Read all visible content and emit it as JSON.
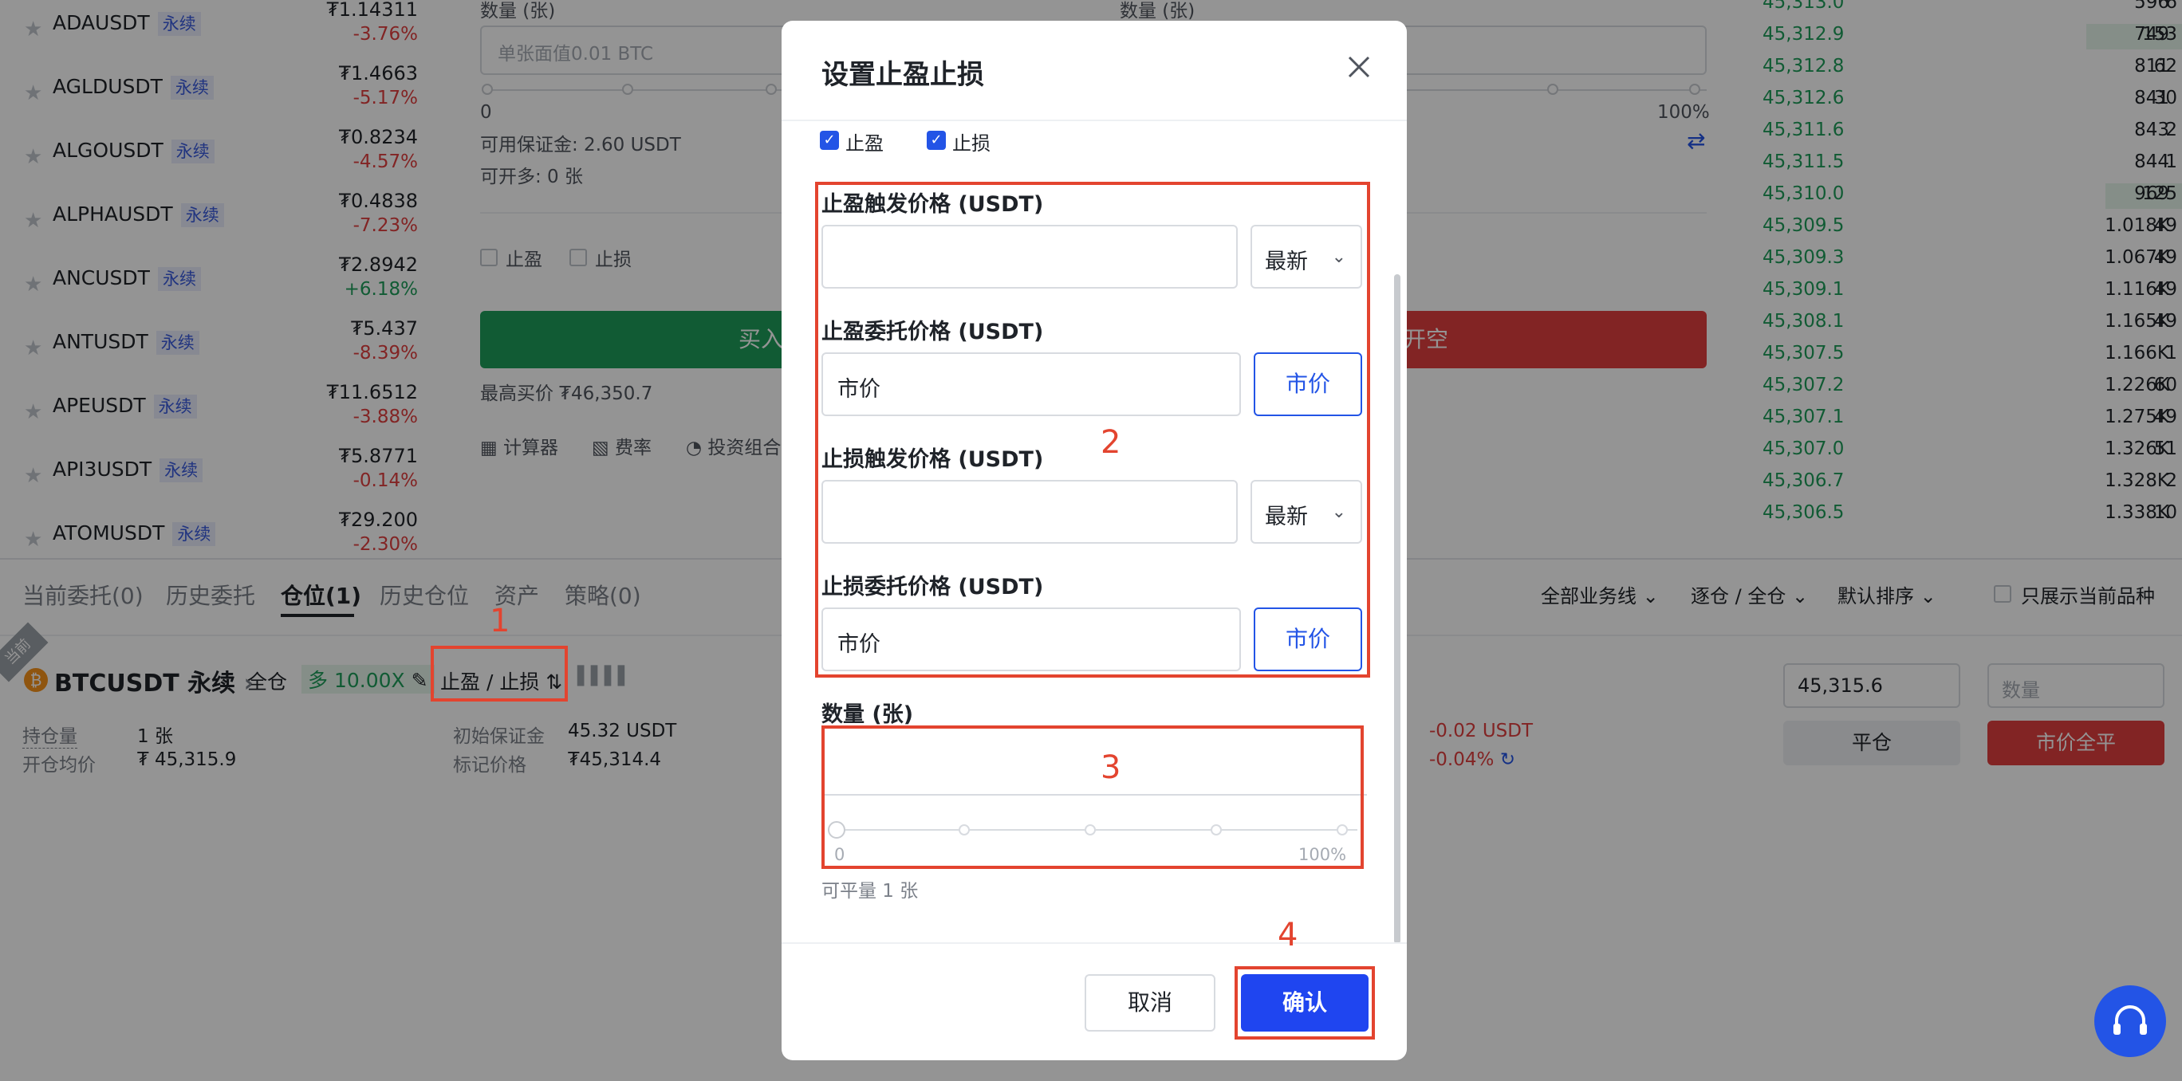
{
  "market_list": [
    {
      "symbol": "ADAUSDT",
      "badge": "永续",
      "price": "₮1.14311",
      "change": "-3.76%",
      "dir": "neg"
    },
    {
      "symbol": "AGLDUSDT",
      "badge": "永续",
      "price": "₮1.4663",
      "change": "-5.17%",
      "dir": "neg"
    },
    {
      "symbol": "ALGOUSDT",
      "badge": "永续",
      "price": "₮0.8234",
      "change": "-4.57%",
      "dir": "neg"
    },
    {
      "symbol": "ALPHAUSDT",
      "badge": "永续",
      "price": "₮0.4838",
      "change": "-7.23%",
      "dir": "neg"
    },
    {
      "symbol": "ANCUSDT",
      "badge": "永续",
      "price": "₮2.8942",
      "change": "+6.18%",
      "dir": "pos"
    },
    {
      "symbol": "ANTUSDT",
      "badge": "永续",
      "price": "₮5.437",
      "change": "-8.39%",
      "dir": "neg"
    },
    {
      "symbol": "APEUSDT",
      "badge": "永续",
      "price": "₮11.6512",
      "change": "-3.88%",
      "dir": "neg"
    },
    {
      "symbol": "API3USDT",
      "badge": "永续",
      "price": "₮5.8771",
      "change": "-0.14%",
      "dir": "neg"
    },
    {
      "symbol": "ATOMUSDT",
      "badge": "永续",
      "price": "₮29.200",
      "change": "-2.30%",
      "dir": "neg"
    }
  ],
  "order_panel": {
    "qty_label_left": "数量 (张)",
    "qty_label_right": "数量 (张)",
    "qty_placeholder": "单张面值0.01 BTC",
    "slider_min": "0",
    "slider_max": "100%",
    "available_margin": "可用保证金: 2.60 USDT",
    "can_open": "可开多: 0 张",
    "tp_label": "止盈",
    "sl_label": "止损",
    "buy_button": "买入开多",
    "sell_button": "卖出开空",
    "max_buy": "最高买价 ₮46,350.7",
    "calculator": "计算器",
    "fee_rate": "费率",
    "portfolio": "投资组合"
  },
  "orderbook": [
    {
      "price": "45,313.0",
      "size": "6",
      "total": "596"
    },
    {
      "price": "45,312.9",
      "size": "153",
      "total": "749"
    },
    {
      "price": "45,312.8",
      "size": "62",
      "total": "811"
    },
    {
      "price": "45,312.6",
      "size": "30",
      "total": "841"
    },
    {
      "price": "45,311.6",
      "size": "2",
      "total": "843"
    },
    {
      "price": "45,311.5",
      "size": "1",
      "total": "844"
    },
    {
      "price": "45,310.0",
      "size": "125",
      "total": "969"
    },
    {
      "price": "45,309.5",
      "size": "49",
      "total": "1.018K"
    },
    {
      "price": "45,309.3",
      "size": "49",
      "total": "1.067K"
    },
    {
      "price": "45,309.1",
      "size": "49",
      "total": "1.116K"
    },
    {
      "price": "45,308.1",
      "size": "49",
      "total": "1.165K"
    },
    {
      "price": "45,307.5",
      "size": "1",
      "total": "1.166K"
    },
    {
      "price": "45,307.2",
      "size": "60",
      "total": "1.226K"
    },
    {
      "price": "45,307.1",
      "size": "49",
      "total": "1.275K"
    },
    {
      "price": "45,307.0",
      "size": "51",
      "total": "1.326K"
    },
    {
      "price": "45,306.7",
      "size": "2",
      "total": "1.328K"
    },
    {
      "price": "45,306.5",
      "size": "10",
      "total": "1.338K"
    }
  ],
  "bottom": {
    "tabs": [
      "当前委托(0)",
      "历史委托",
      "仓位(1)",
      "历史仓位",
      "资产",
      "策略(0)"
    ],
    "filters": [
      "全部业务线",
      "逐仓 / 全仓",
      "默认排序"
    ],
    "only_current": "只展示当前品种",
    "current_tag": "当前",
    "position": {
      "symbol": "BTCUSDT 永续",
      "margin_mode": "全仓",
      "side_leverage": "多 10.00X",
      "tp_sl": "止盈 / 止损",
      "holding_label": "持仓量",
      "holding_value": "1 张",
      "avg_price_label": "开仓均价",
      "avg_price_value": "₮ 45,315.9",
      "init_margin_label": "初始保证金",
      "init_margin_value": "45.32 USDT",
      "mark_price_label": "标记价格",
      "mark_price_value": "₮45,314.4",
      "pnl": "-0.02 USDT",
      "pnl_pct": "-0.04%",
      "close_price": "45,315.6",
      "close_qty_placeholder": "数量",
      "close_button": "平仓",
      "market_close_button": "市价全平"
    },
    "annotation_1": "1"
  },
  "modal": {
    "title": "设置止盈止损",
    "check_tp": "止盈",
    "check_sl": "止损",
    "tp_trigger_label": "止盈触发价格 (USDT)",
    "tp_trigger_select": "最新",
    "tp_order_label": "止盈委托价格 (USDT)",
    "tp_order_value": "市价",
    "tp_order_button": "市价",
    "sl_trigger_label": "止损触发价格 (USDT)",
    "sl_trigger_select": "最新",
    "sl_order_label": "止损委托价格 (USDT)",
    "sl_order_value": "市价",
    "sl_order_button": "市价",
    "qty_label": "数量 (张)",
    "slider_min": "0",
    "slider_max": "100%",
    "closable": "可平量 1 张",
    "cancel": "取消",
    "confirm": "确认",
    "annotations": [
      "2",
      "3",
      "4"
    ]
  },
  "colors": {
    "accent": "#2354e6",
    "green": "#1e9e5a",
    "red": "#e03e3e",
    "annotation": "#e3442f"
  }
}
